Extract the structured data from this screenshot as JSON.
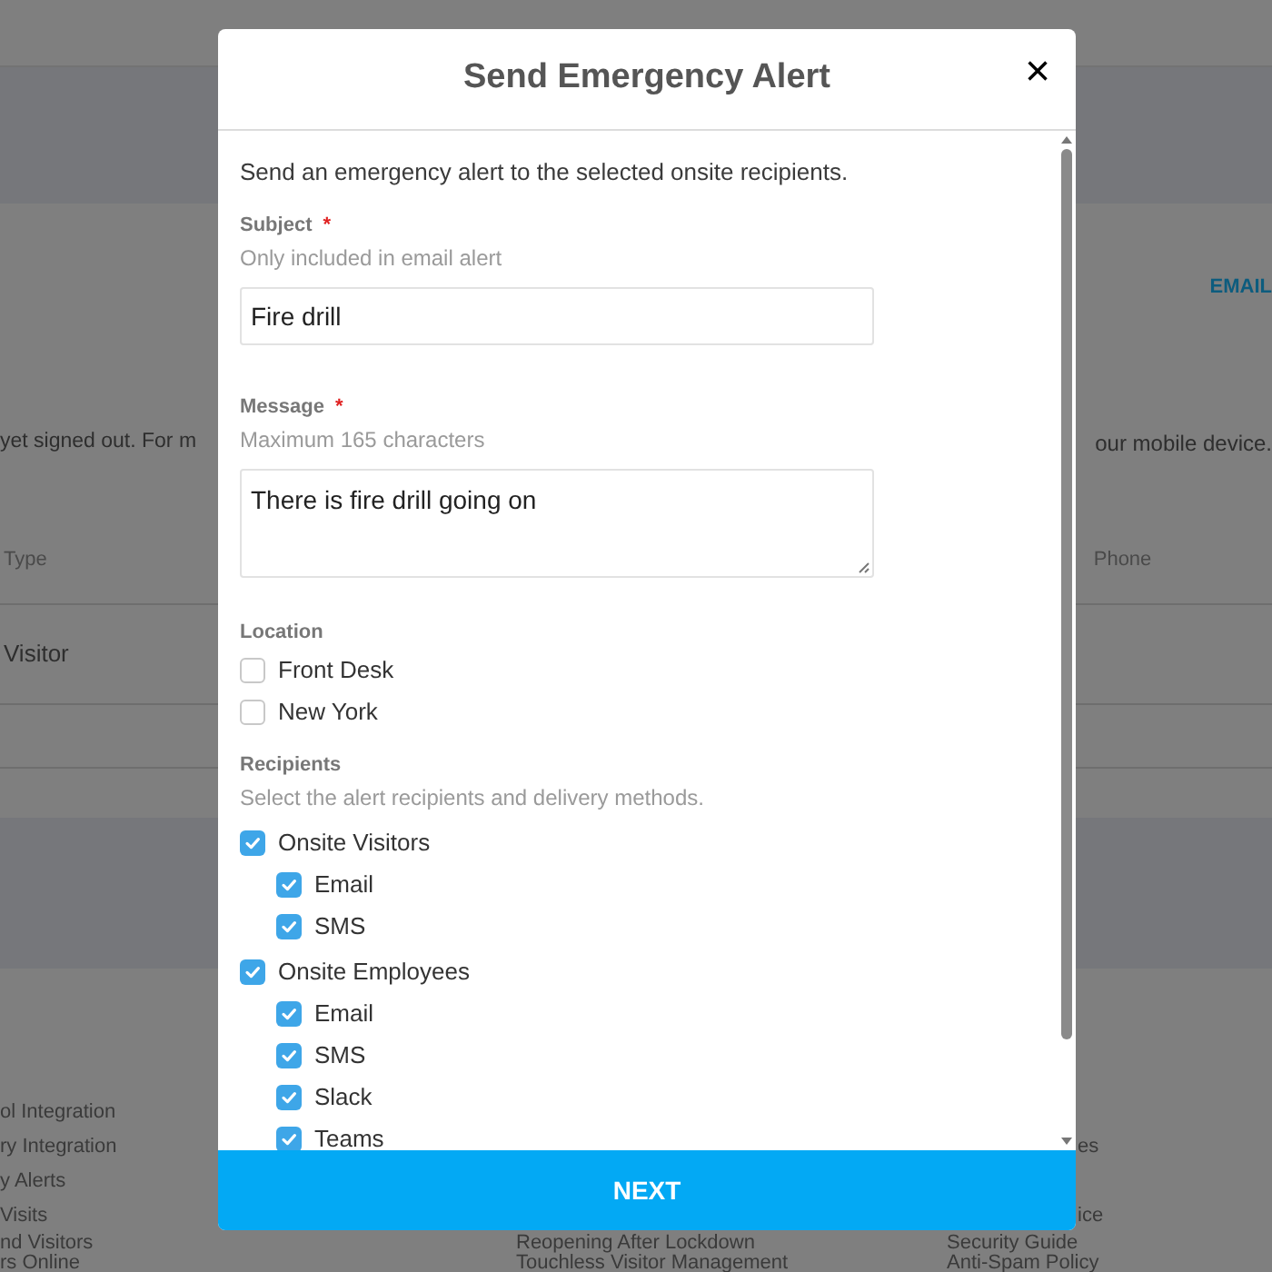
{
  "background": {
    "email_link": "EMAIL",
    "notice_left": "yet signed out. For m",
    "notice_right": "our mobile device.",
    "table": {
      "columns": [
        "Type",
        "Phone"
      ],
      "rows": [
        [
          "Visitor"
        ]
      ]
    },
    "footer": {
      "rows": [
        {
          "column_1": "ol Integration"
        },
        {
          "column_1": "ry Integration",
          "column_4": "es"
        },
        {
          "column_1": "y Alerts"
        },
        {
          "column_1": "Visits",
          "column_4": "ice"
        },
        {
          "column_1": "nd Visitors",
          "column_2": "Reopening After Lockdown",
          "column_3": "Security Guide"
        },
        {
          "column_1": "rs Online",
          "column_2": "Touchless Visitor Management",
          "column_3": "Anti-Spam Policy"
        }
      ]
    }
  },
  "modal": {
    "title": "Send Emergency Alert",
    "close": "×",
    "intro": "Send an emergency alert to the selected onsite recipients.",
    "subject": {
      "label": "Subject",
      "required_mark": "*",
      "hint": "Only included in email alert",
      "value": "Fire drill"
    },
    "message": {
      "label": "Message",
      "required_mark": "*",
      "hint": "Maximum 165 characters",
      "value": "There is fire drill going on"
    },
    "location": {
      "label": "Location",
      "options": [
        {
          "label": "Front Desk",
          "checked": false
        },
        {
          "label": "New York",
          "checked": false
        }
      ]
    },
    "recipients": {
      "label": "Recipients",
      "hint": "Select the alert recipients and delivery methods.",
      "groups": [
        {
          "label": "Onsite Visitors",
          "checked": true,
          "methods": [
            {
              "label": "Email",
              "checked": true
            },
            {
              "label": "SMS",
              "checked": true
            }
          ]
        },
        {
          "label": "Onsite Employees",
          "checked": true,
          "methods": [
            {
              "label": "Email",
              "checked": true
            },
            {
              "label": "SMS",
              "checked": true
            },
            {
              "label": "Slack",
              "checked": true
            },
            {
              "label": "Teams",
              "checked": true
            }
          ]
        }
      ]
    },
    "button": "NEXT"
  }
}
